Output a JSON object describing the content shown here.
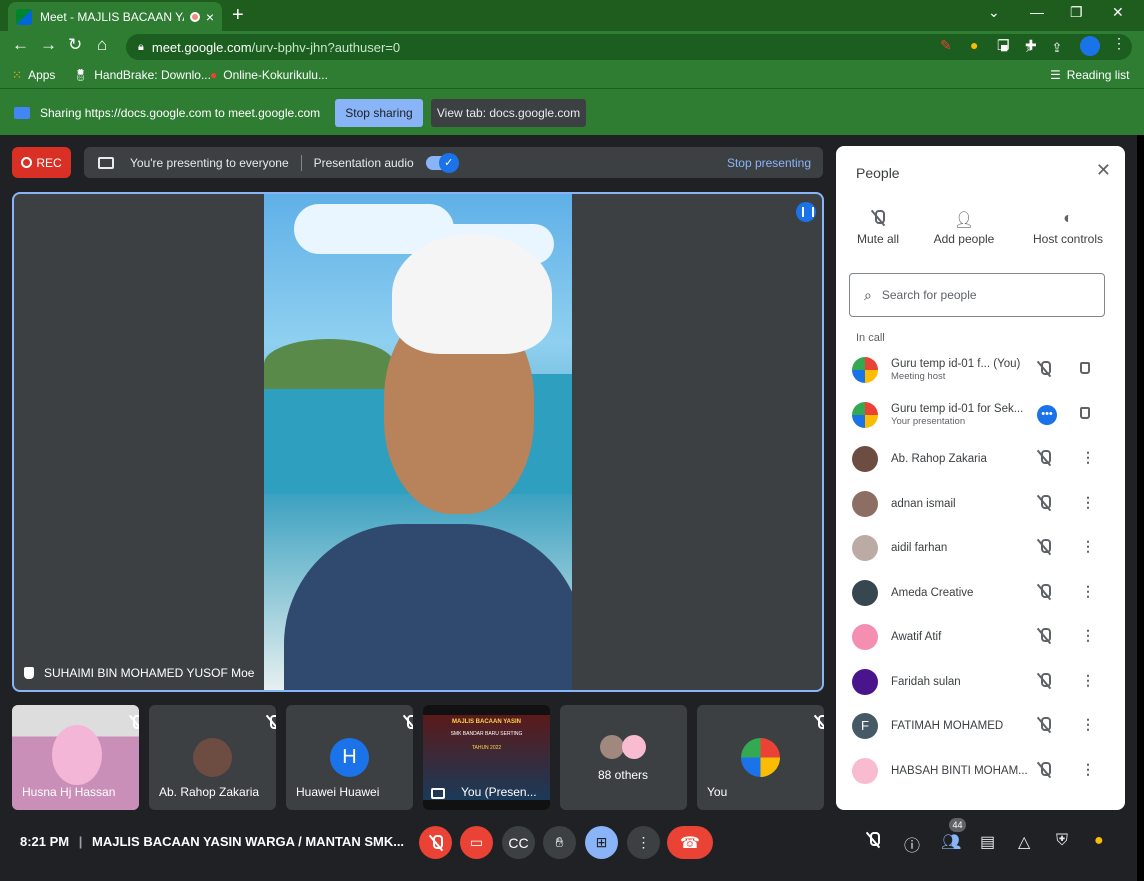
{
  "browser": {
    "tab_title": "Meet - MAJLIS BACAAN YASI",
    "tab_close": "×",
    "new_tab": "+",
    "url_host": "meet.google.com",
    "url_path": "/urv-bphv-jhn?authuser=0",
    "window_controls": [
      "⌄",
      "—",
      "❐",
      "✕"
    ],
    "bookmarks": [
      "Apps",
      "HandBrake: Downlo...",
      "Online-Kokurikulu..."
    ],
    "reading_list": "Reading list"
  },
  "sharebar": {
    "message": "Sharing https://docs.google.com to meet.google.com",
    "stop_sharing": "Stop sharing",
    "view_tab": "View tab: docs.google.com"
  },
  "meet": {
    "rec_label": "REC",
    "presenting_text": "You're presenting to everyone",
    "presentation_audio": "Presentation audio",
    "stop_presenting": "Stop presenting",
    "main_speaker": "SUHAIMI BIN MOHAMED YUSOF Moe",
    "tiles": [
      {
        "name": "Husna Hj Hassan"
      },
      {
        "name": "Ab. Rahop Zakaria"
      },
      {
        "name": "Huawei Huawei",
        "initial": "H"
      },
      {
        "name": "You (Presen..."
      },
      {
        "name": "88 others"
      },
      {
        "name": "You"
      }
    ],
    "slide_title": "MAJLIS BACAAN YASIN",
    "slide_sub": "SMK BANDAR BARU SERTING",
    "slide_year": "TAHUN 2022"
  },
  "people_panel": {
    "title": "People",
    "host_controls": [
      "Mute all",
      "Add people",
      "Host controls"
    ],
    "search_placeholder": "Search for people",
    "section": "In call",
    "people": [
      {
        "name": "Guru temp id-01 f...  (You)",
        "sub": "Meeting host"
      },
      {
        "name": "Guru temp id-01 for Sek...",
        "sub": "Your presentation"
      },
      {
        "name": "Ab. Rahop Zakaria"
      },
      {
        "name": "adnan ismail"
      },
      {
        "name": "aidil farhan"
      },
      {
        "name": "Ameda Creative"
      },
      {
        "name": "Awatif Atif"
      },
      {
        "name": "Faridah sulan"
      },
      {
        "name": "FATIMAH MOHAMED",
        "initial": "F"
      },
      {
        "name": "HABSAH BINTI MOHAM..."
      }
    ]
  },
  "bottom_bar": {
    "time": "8:21 PM",
    "separator": "|",
    "meeting_title": "MAJLIS BACAAN YASIN WARGA / MANTAN SMK...",
    "participant_count": "44"
  },
  "colors": {
    "chrome_green": "#2e7d32",
    "meet_dark": "#202124",
    "accent_blue": "#8ab4f8",
    "red": "#ea4335"
  }
}
